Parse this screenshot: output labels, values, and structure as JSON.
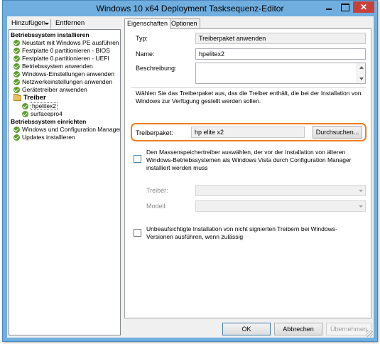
{
  "window": {
    "title": "Windows 10 x64 Deployment Tasksequenz-Editor",
    "close_glyph": "✕"
  },
  "toolbar": {
    "add_label": "Hinzufügen",
    "remove_label": "Entfernen"
  },
  "sequence": [
    {
      "type": "group",
      "label": "Betriebssystem installieren"
    },
    {
      "type": "step",
      "label": "Neustart mit Windows PE ausführen"
    },
    {
      "type": "step",
      "label": "Festplatte 0 partitionieren - BIOS"
    },
    {
      "type": "step",
      "label": "Festplatte 0 partitionieren - UEFI"
    },
    {
      "type": "step",
      "label": "Betriebssystem anwenden"
    },
    {
      "type": "step",
      "label": "Windows-Einstellungen anwenden"
    },
    {
      "type": "step",
      "label": "Netzwerkeinstellungen anwenden"
    },
    {
      "type": "step",
      "label": "Gerätetreiber anwenden"
    },
    {
      "type": "folder",
      "label": "Treiber"
    },
    {
      "type": "substep",
      "label": "hpelitex2"
    },
    {
      "type": "substep",
      "label": "surfacepro4"
    },
    {
      "type": "group",
      "label": "Betriebssystem einrichten"
    },
    {
      "type": "step",
      "label": "Windows und Configuration Manager einrichten"
    },
    {
      "type": "step",
      "label": "Updates installieren"
    }
  ],
  "tabs": {
    "properties": "Eigenschaften",
    "options": "Optionen"
  },
  "properties": {
    "type_label": "Typ:",
    "type_value": "Treiberpaket anwenden",
    "name_label": "Name:",
    "name_value": "hpelitex2",
    "description_label": "Beschreibung:",
    "description_value": "",
    "instruction": "Wählen Sie das Treiberpaket aus, das die Treiber enthält, die bei der Installation von Windows zur Verfügung gestellt werden sollen.",
    "driver_package_label": "Treiberpaket:",
    "driver_package_value": "hp elite x2",
    "browse_label": "Durchsuchen...",
    "mass_storage_text": "Den Massenspeichertreiber auswählen, der vor der Installation von älteren Windows-Betriebssystemen als Windows Vista durch Configuration Manager installiert werden muss",
    "driver_label": "Treiber:",
    "model_label": "Modell:",
    "unattended_text": "Unbeaufsichtigte Installation von nicht signierten Treibern bei Windows-Versionen ausführen, wenn zulässig"
  },
  "buttons": {
    "ok": "OK",
    "cancel": "Abbrechen",
    "apply": "Übernehmen"
  },
  "colors": {
    "highlight": "#f07c1e",
    "success": "#5aa02c",
    "frame": "#70aee0"
  }
}
